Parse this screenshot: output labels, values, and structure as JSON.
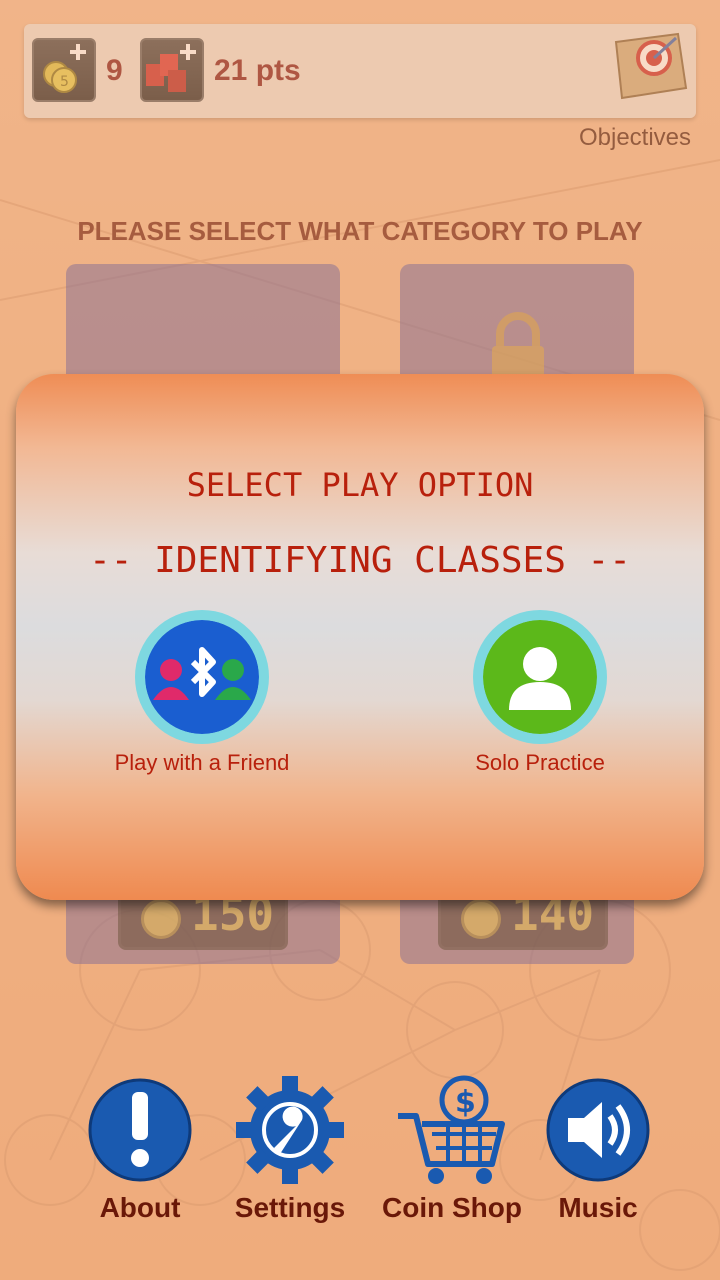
{
  "header": {
    "coins_value": "9",
    "points_value": "21 pts",
    "objectives_label": "Objectives"
  },
  "prompt": "PLEASE SELECT WHAT CATEGORY TO PLAY",
  "categories": [
    {
      "price": "150"
    },
    {
      "price": "140"
    }
  ],
  "modal": {
    "title": "SELECT PLAY OPTION",
    "subtitle": "-- IDENTIFYING CLASSES --",
    "options": [
      {
        "label": "Play with a Friend",
        "icon": "bluetooth-friends-icon"
      },
      {
        "label": "Solo Practice",
        "icon": "person-icon"
      }
    ]
  },
  "nav": [
    {
      "label": "About",
      "icon": "info-icon"
    },
    {
      "label": "Settings",
      "icon": "gear-wrench-icon"
    },
    {
      "label": "Coin Shop",
      "icon": "cart-icon"
    },
    {
      "label": "Music",
      "icon": "speaker-icon"
    }
  ],
  "colors": {
    "title_red": "#b8200c",
    "dark_brown": "#6a1808",
    "nav_blue": "#1a5ab0"
  }
}
